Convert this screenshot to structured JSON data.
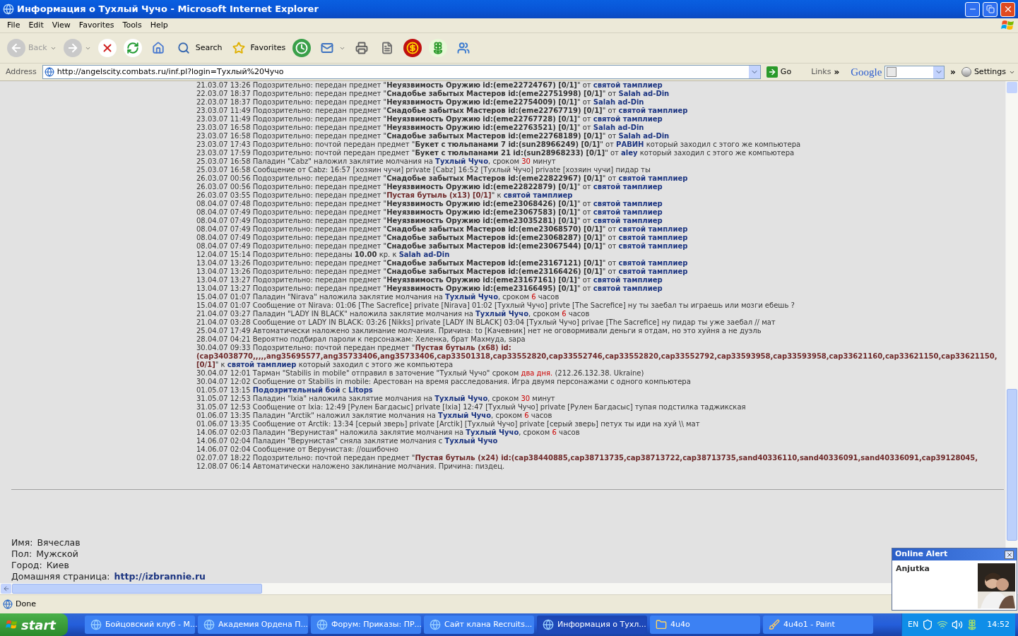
{
  "window": {
    "title": "Информация о Тухлый Чучо - Microsoft Internet Explorer"
  },
  "menu": [
    "File",
    "Edit",
    "View",
    "Favorites",
    "Tools",
    "Help"
  ],
  "toolbar": [
    {
      "kind": "back",
      "label": "Back",
      "disabled": true
    },
    {
      "kind": "forward",
      "disabled": true
    },
    {
      "kind": "stop",
      "disabled": false
    },
    {
      "kind": "refresh",
      "disabled": false
    },
    {
      "kind": "home",
      "disabled": false
    },
    {
      "kind": "search",
      "label": "Search",
      "disabled": false
    },
    {
      "kind": "favorites",
      "label": "Favorites",
      "disabled": false
    },
    {
      "kind": "history",
      "disabled": false
    },
    {
      "kind": "mail",
      "disabled": false
    },
    {
      "kind": "print",
      "disabled": false
    },
    {
      "kind": "edit",
      "disabled": false
    },
    {
      "kind": "coin",
      "disabled": false
    },
    {
      "kind": "flower",
      "disabled": false
    },
    {
      "kind": "messenger",
      "disabled": false
    }
  ],
  "address": {
    "label": "Address",
    "url": "http://angelscity.combats.ru/inf.pl?login=Тухлый%20Чучо",
    "go": "Go",
    "links": "Links",
    "chevron": "»"
  },
  "google": {
    "logo": "Google",
    "chevron": "»",
    "settings": "Settings"
  },
  "log": [
    [
      {
        "kind": "plain",
        "text": "21.03.07 13:26 Подозрительно: передан предмет \""
      },
      {
        "kind": "item",
        "text": "Неуязвимость Оружию id:(eme22724767) [0/1]"
      },
      {
        "kind": "plain",
        "text": "\" от "
      },
      {
        "kind": "nick",
        "text": "святой тамплиер"
      }
    ],
    [
      {
        "kind": "plain",
        "text": "22.03.07 18:37 Подозрительно: передан предмет \""
      },
      {
        "kind": "item",
        "text": "Снадобье забытых Мастеров id:(eme22751998) [0/1]"
      },
      {
        "kind": "plain",
        "text": "\" от "
      },
      {
        "kind": "nick",
        "text": "Salah ad-Din"
      }
    ],
    [
      {
        "kind": "plain",
        "text": "22.03.07 18:37 Подозрительно: передан предмет \""
      },
      {
        "kind": "item",
        "text": "Неуязвимость Оружию id:(eme22754009) [0/1]"
      },
      {
        "kind": "plain",
        "text": "\" от "
      },
      {
        "kind": "nick",
        "text": "Salah ad-Din"
      }
    ],
    [
      {
        "kind": "plain",
        "text": "23.03.07 11:49 Подозрительно: передан предмет \""
      },
      {
        "kind": "item",
        "text": "Снадобье забытых Мастеров id:(eme22767719) [0/1]"
      },
      {
        "kind": "plain",
        "text": "\" от "
      },
      {
        "kind": "nick",
        "text": "святой тамплиер"
      }
    ],
    [
      {
        "kind": "plain",
        "text": "23.03.07 11:49 Подозрительно: передан предмет \""
      },
      {
        "kind": "item",
        "text": "Неуязвимость Оружию id:(eme22767728) [0/1]"
      },
      {
        "kind": "plain",
        "text": "\" от "
      },
      {
        "kind": "nick",
        "text": "святой тамплиер"
      }
    ],
    [
      {
        "kind": "plain",
        "text": "23.03.07 16:58 Подозрительно: передан предмет \""
      },
      {
        "kind": "item",
        "text": "Неуязвимость Оружию id:(eme22763521) [0/1]"
      },
      {
        "kind": "plain",
        "text": "\" от "
      },
      {
        "kind": "nick",
        "text": "Salah ad-Din"
      }
    ],
    [
      {
        "kind": "plain",
        "text": "23.03.07 16:58 Подозрительно: передан предмет \""
      },
      {
        "kind": "item",
        "text": "Снадобье забытых Мастеров id:(eme22768189) [0/1]"
      },
      {
        "kind": "plain",
        "text": "\" от "
      },
      {
        "kind": "nick",
        "text": "Salah ad-Din"
      }
    ],
    [
      {
        "kind": "plain",
        "text": "23.03.07 17:43 Подозрительно: почтой передан предмет \""
      },
      {
        "kind": "item",
        "text": "Букет с тюльпанами 7 id:(sun28966249) [0/1]"
      },
      {
        "kind": "plain",
        "text": "\" от "
      },
      {
        "kind": "nick",
        "text": "РАВИН"
      },
      {
        "kind": "plain",
        "text": " который заходил с этого же компьютера"
      }
    ],
    [
      {
        "kind": "plain",
        "text": "23.03.07 17:59 Подозрительно: почтой передан предмет \""
      },
      {
        "kind": "item",
        "text": "Букет с тюльпанами 21 id:(sun28968233) [0/1]"
      },
      {
        "kind": "plain",
        "text": "\" от "
      },
      {
        "kind": "nick",
        "text": "aley"
      },
      {
        "kind": "plain",
        "text": " который заходил с этого же компьютера"
      }
    ],
    [
      {
        "kind": "plain",
        "text": "25.03.07 16:58 Паладин \"Cabz\" наложил заклятие молчания на "
      },
      {
        "kind": "nick",
        "text": "Тухлый Чучо"
      },
      {
        "kind": "plain",
        "text": ", сроком "
      },
      {
        "kind": "num",
        "text": "30"
      },
      {
        "kind": "plain",
        "text": " минут"
      }
    ],
    [
      {
        "kind": "plain",
        "text": "25.03.07 16:58 Сообщение от Cabz: 16:57 [хозяин чучи] private [Cabz] 16:52 [Тухлый Чучо] private [хозяин чучи] пидар ты"
      }
    ],
    [
      {
        "kind": "plain",
        "text": "26.03.07 00:56 Подозрительно: передан предмет \""
      },
      {
        "kind": "item",
        "text": "Снадобье забытых Мастеров id:(eme22822967) [0/1]"
      },
      {
        "kind": "plain",
        "text": "\" от "
      },
      {
        "kind": "nick",
        "text": "святой тамплиер"
      }
    ],
    [
      {
        "kind": "plain",
        "text": "26.03.07 00:56 Подозрительно: передан предмет \""
      },
      {
        "kind": "item",
        "text": "Неуязвимость Оружию id:(eme22822879) [0/1]"
      },
      {
        "kind": "plain",
        "text": "\" от "
      },
      {
        "kind": "nick",
        "text": "святой тамплиер"
      }
    ],
    [
      {
        "kind": "plain",
        "text": "26.03.07 03:55 Подозрительно: передан предмет \""
      },
      {
        "kind": "rare",
        "text": "Пустая бутыль (x13) [0/1]"
      },
      {
        "kind": "plain",
        "text": "\" к "
      },
      {
        "kind": "nick",
        "text": "святой тамплиер"
      }
    ],
    [
      {
        "kind": "plain",
        "text": "08.04.07 07:48 Подозрительно: передан предмет \""
      },
      {
        "kind": "item",
        "text": "Неуязвимость Оружию id:(eme23068426) [0/1]"
      },
      {
        "kind": "plain",
        "text": "\" от "
      },
      {
        "kind": "nick",
        "text": "святой тамплиер"
      }
    ],
    [
      {
        "kind": "plain",
        "text": "08.04.07 07:49 Подозрительно: передан предмет \""
      },
      {
        "kind": "item",
        "text": "Неуязвимость Оружию id:(eme23067583) [0/1]"
      },
      {
        "kind": "plain",
        "text": "\" от "
      },
      {
        "kind": "nick",
        "text": "святой тамплиер"
      }
    ],
    [
      {
        "kind": "plain",
        "text": "08.04.07 07:49 Подозрительно: передан предмет \""
      },
      {
        "kind": "item",
        "text": "Неуязвимость Оружию id:(eme23035281) [0/1]"
      },
      {
        "kind": "plain",
        "text": "\" от "
      },
      {
        "kind": "nick",
        "text": "святой тамплиер"
      }
    ],
    [
      {
        "kind": "plain",
        "text": "08.04.07 07:49 Подозрительно: передан предмет \""
      },
      {
        "kind": "item",
        "text": "Снадобье забытых Мастеров id:(eme23068570) [0/1]"
      },
      {
        "kind": "plain",
        "text": "\" от "
      },
      {
        "kind": "nick",
        "text": "святой тамплиер"
      }
    ],
    [
      {
        "kind": "plain",
        "text": "08.04.07 07:49 Подозрительно: передан предмет \""
      },
      {
        "kind": "item",
        "text": "Снадобье забытых Мастеров id:(eme23068287) [0/1]"
      },
      {
        "kind": "plain",
        "text": "\" от "
      },
      {
        "kind": "nick",
        "text": "святой тамплиер"
      }
    ],
    [
      {
        "kind": "plain",
        "text": "08.04.07 07:49 Подозрительно: передан предмет \""
      },
      {
        "kind": "item",
        "text": "Снадобье забытых Мастеров id:(eme23067544) [0/1]"
      },
      {
        "kind": "plain",
        "text": "\" от "
      },
      {
        "kind": "nick",
        "text": "святой тамплиер"
      }
    ],
    [
      {
        "kind": "plain",
        "text": "12.04.07 15:14 Подозрительно: переданы "
      },
      {
        "kind": "item",
        "text": "10.00"
      },
      {
        "kind": "plain",
        "text": " кр. к "
      },
      {
        "kind": "nick",
        "text": "Salah ad-Din"
      }
    ],
    [
      {
        "kind": "plain",
        "text": "13.04.07 13:26 Подозрительно: передан предмет \""
      },
      {
        "kind": "item",
        "text": "Снадобье забытых Мастеров id:(eme23167121) [0/1]"
      },
      {
        "kind": "plain",
        "text": "\" от "
      },
      {
        "kind": "nick",
        "text": "святой тамплиер"
      }
    ],
    [
      {
        "kind": "plain",
        "text": "13.04.07 13:26 Подозрительно: передан предмет \""
      },
      {
        "kind": "item",
        "text": "Снадобье забытых Мастеров id:(eme23166426) [0/1]"
      },
      {
        "kind": "plain",
        "text": "\" от "
      },
      {
        "kind": "nick",
        "text": "святой тамплиер"
      }
    ],
    [
      {
        "kind": "plain",
        "text": "13.04.07 13:27 Подозрительно: передан предмет \""
      },
      {
        "kind": "item",
        "text": "Неуязвимость Оружию id:(eme23167161) [0/1]"
      },
      {
        "kind": "plain",
        "text": "\" от "
      },
      {
        "kind": "nick",
        "text": "святой тамплиер"
      }
    ],
    [
      {
        "kind": "plain",
        "text": "13.04.07 13:27 Подозрительно: передан предмет \""
      },
      {
        "kind": "item",
        "text": "Неуязвимость Оружию id:(eme23166495) [0/1]"
      },
      {
        "kind": "plain",
        "text": "\" от "
      },
      {
        "kind": "nick",
        "text": "святой тамплиер"
      }
    ],
    [
      {
        "kind": "plain",
        "text": "15.04.07 01:07 Паладин \"Nirava\" наложила заклятие молчания на "
      },
      {
        "kind": "nick",
        "text": "Тухлый Чучо"
      },
      {
        "kind": "plain",
        "text": ", сроком "
      },
      {
        "kind": "num",
        "text": "6"
      },
      {
        "kind": "plain",
        "text": " часов"
      }
    ],
    [
      {
        "kind": "plain",
        "text": "15.04.07 01:07 Сообщение от Nirava: 01:06 [The Sacrefice] private [Nirava] 01:02 [Тухлый Чучо] privte [The Sacrefice] ну ты заебал ты играешь или мозги ебешь ?"
      }
    ],
    [
      {
        "kind": "plain",
        "text": "21.04.07 03:27 Паладин \"LADY IN BLACK\" наложила заклятие молчания на "
      },
      {
        "kind": "nick",
        "text": "Тухлый Чучо"
      },
      {
        "kind": "plain",
        "text": ", сроком "
      },
      {
        "kind": "num",
        "text": "6"
      },
      {
        "kind": "plain",
        "text": " часов"
      }
    ],
    [
      {
        "kind": "plain",
        "text": "21.04.07 03:28 Сообщение от LADY IN BLACK: 03:26 [Nikks] private [LADY IN BLACK] 03:04 [Тухлый Чучо] privae [The Sacrefice] ну пидар ты уже заебал // мат"
      }
    ],
    [
      {
        "kind": "plain",
        "text": "25.04.07 17:49 Автоматически наложено заклинание молчания. Причина: to [Качевник] нет не оговормивали деньги я отдам, но это хуйня а не дуэль"
      }
    ],
    [
      {
        "kind": "plain",
        "text": "28.04.07 04:21 Вероятно подбирал пароли к персонажам: Хеленка, брат Махмуда, sapa"
      }
    ],
    [
      {
        "kind": "plain",
        "text": "30.04.07 09:33 Подозрительно: почтой передан предмет \""
      },
      {
        "kind": "rare",
        "text": "Пустая бутыль (x68) id:"
      }
    ],
    [
      {
        "kind": "rare",
        "text": "(cap34038770,,,,,ang35695577,ang35733406,ang35733406,cap33501318,cap33552820,cap33552746,cap33552820,cap33552792,cap33593958,cap33593958,cap33621160,cap33621150,cap33621150,"
      }
    ],
    [
      {
        "kind": "rare",
        "text": "[0/1]"
      },
      {
        "kind": "plain",
        "text": "\" к "
      },
      {
        "kind": "nick",
        "text": "святой тамплиер"
      },
      {
        "kind": "plain",
        "text": " который заходил с этого же компьютера"
      }
    ],
    [
      {
        "kind": "plain",
        "text": "30.04.07 12:01 Тарман \"Stabilis in mobile\" отправил в заточение \"Тухлый Чучо\" сроком "
      },
      {
        "kind": "num",
        "text": "два дня."
      },
      {
        "kind": "plain",
        "text": " (212.26.132.38. Ukraine)"
      }
    ],
    [
      {
        "kind": "plain",
        "text": "30.04.07 12:02 Сообщение от Stabilis in mobile: Арестован на время расследования. Игра двумя персонажами с одного компьютера"
      }
    ],
    [
      {
        "kind": "plain",
        "text": "01.05.07 13:15 "
      },
      {
        "kind": "fight",
        "text": "Подозрительный бой"
      },
      {
        "kind": "plain",
        "text": " с "
      },
      {
        "kind": "nick",
        "text": "Litops"
      }
    ],
    [
      {
        "kind": "plain",
        "text": "31.05.07 12:53 Паладин \"Ixia\" наложила заклятие молчания на "
      },
      {
        "kind": "nick",
        "text": "Тухлый Чучо"
      },
      {
        "kind": "plain",
        "text": ", сроком "
      },
      {
        "kind": "num",
        "text": "30"
      },
      {
        "kind": "plain",
        "text": " минут"
      }
    ],
    [
      {
        "kind": "plain",
        "text": "31.05.07 12:53 Сообщение от Ixia: 12:49 [Рулен Багдасыс] private [Ixia] 12:47 [Тухлый Чучо] private [Рулен Багдасыс] тупая подстилка таджикская"
      }
    ],
    [
      {
        "kind": "plain",
        "text": "01.06.07 13:35 Паладин \"Arctik\" наложил заклятие молчания на "
      },
      {
        "kind": "nick",
        "text": "Тухлый Чучо"
      },
      {
        "kind": "plain",
        "text": ", сроком "
      },
      {
        "kind": "num",
        "text": "6"
      },
      {
        "kind": "plain",
        "text": " часов"
      }
    ],
    [
      {
        "kind": "plain",
        "text": "01.06.07 13:35 Сообщение от Arctik: 13:34 [серый зверь] private [Arctik] [Тухлый Чучо] private [серый зверь] петух ты иди на хуй \\\\ мат"
      }
    ],
    [
      {
        "kind": "plain",
        "text": "14.06.07 02:03 Паладин \"Верунистая\" наложила заклятие молчания на "
      },
      {
        "kind": "nick",
        "text": "Тухлый Чучо"
      },
      {
        "kind": "plain",
        "text": ", сроком "
      },
      {
        "kind": "num",
        "text": "6"
      },
      {
        "kind": "plain",
        "text": " часов"
      }
    ],
    [
      {
        "kind": "plain",
        "text": "14.06.07 02:04 Паладин \"Верунистая\" сняла заклятие молчания с "
      },
      {
        "kind": "nick",
        "text": "Тухлый Чучо"
      }
    ],
    [
      {
        "kind": "plain",
        "text": "14.06.07 02:04 Сообщение от Верунистая: //ошибочно"
      }
    ],
    [
      {
        "kind": "plain",
        "text": "02.07.07 18:22 Подозрительно: почтой передан предмет \""
      },
      {
        "kind": "rare",
        "text": "Пустая бутыль (x24) id:(cap38440885,cap38713735,cap38713722,cap38713735,sand40336110,sand40336091,sand40336091,cap39128045,"
      }
    ],
    [
      {
        "kind": "plain",
        "text": "12.08.07 06:14 Автоматически наложено заклинание молчания. Причина: пиздец."
      }
    ]
  ],
  "profile": [
    {
      "kind": "text",
      "label": "Имя:",
      "value": "Вячеслав"
    },
    {
      "kind": "text",
      "label": "Пол:",
      "value": "Мужской"
    },
    {
      "kind": "text",
      "label": "Город:",
      "value": "Киев"
    },
    {
      "kind": "link",
      "label": "Домашняя страница:",
      "value": "http://izbrannie.ru"
    }
  ],
  "status_bar": {
    "text": "Done"
  },
  "alert": {
    "title": "Online Alert",
    "name": "Anjutka"
  },
  "taskbar": {
    "start": "start",
    "items": [
      {
        "kind": "ie",
        "label": "Бойцовский клуб - М...",
        "selected": false
      },
      {
        "kind": "ie",
        "label": "Академия Ордена П...",
        "selected": false
      },
      {
        "kind": "ie",
        "label": "Форум: Приказы: ПР...",
        "selected": false
      },
      {
        "kind": "ie",
        "label": "Сайт клана Recruits...",
        "selected": false
      },
      {
        "kind": "ie",
        "label": "Информация о Тухл...",
        "selected": true
      },
      {
        "kind": "folder",
        "label": "4u4o",
        "selected": false
      },
      {
        "kind": "paint",
        "label": "4u4o1 - Paint",
        "selected": false
      }
    ],
    "lang": "EN",
    "clock": "14:52"
  }
}
